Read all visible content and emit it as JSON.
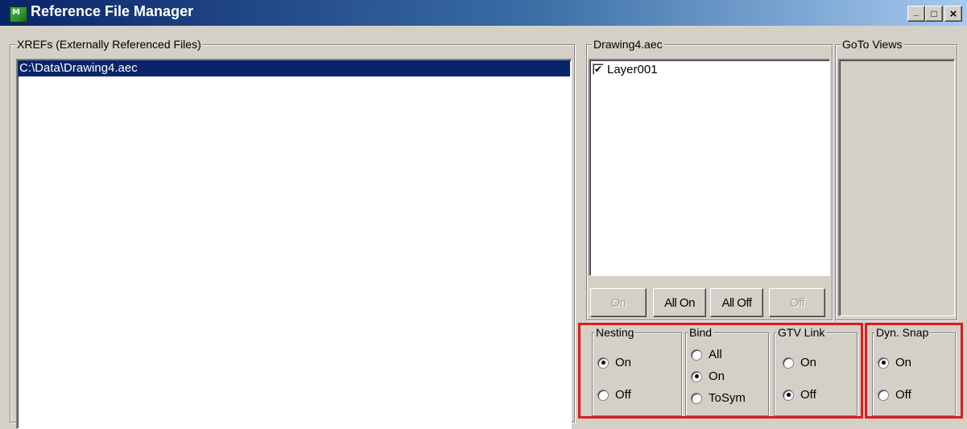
{
  "window": {
    "title": "Reference File Manager",
    "app_icon_text": "M",
    "controls": [
      "_",
      "□",
      "×"
    ]
  },
  "xrefs": {
    "legend": "XREFs (Externally Referenced Files)",
    "items": [
      "C:\\Data\\Drawing4.aec"
    ],
    "selected_index": 0
  },
  "drawing": {
    "legend": "Drawing4.aec",
    "layers": [
      {
        "label": "Layer001",
        "checked": true
      }
    ],
    "buttons": {
      "on": "On",
      "all_on": "All On",
      "all_off": "All Off",
      "off": "Off"
    }
  },
  "goto": {
    "legend": "GoTo Views"
  },
  "nesting": {
    "legend": "Nesting",
    "options": [
      {
        "label": "On",
        "selected": true
      },
      {
        "label": "Off",
        "selected": false
      }
    ]
  },
  "bind": {
    "legend": "Bind",
    "options": [
      {
        "label": "All",
        "selected": false
      },
      {
        "label": "On",
        "selected": true
      },
      {
        "label": "ToSym",
        "selected": false
      }
    ]
  },
  "gtv_link": {
    "legend": "GTV Link",
    "options": [
      {
        "label": "On",
        "selected": false
      },
      {
        "label": "Off",
        "selected": true
      }
    ]
  },
  "dyn_snap": {
    "legend": "Dyn. Snap",
    "options": [
      {
        "label": "On",
        "selected": true
      },
      {
        "label": "Off",
        "selected": false
      }
    ]
  },
  "colors": {
    "highlight": "#dd1c1c",
    "selection": "#0a246a",
    "titlebar": "#0a246a"
  }
}
